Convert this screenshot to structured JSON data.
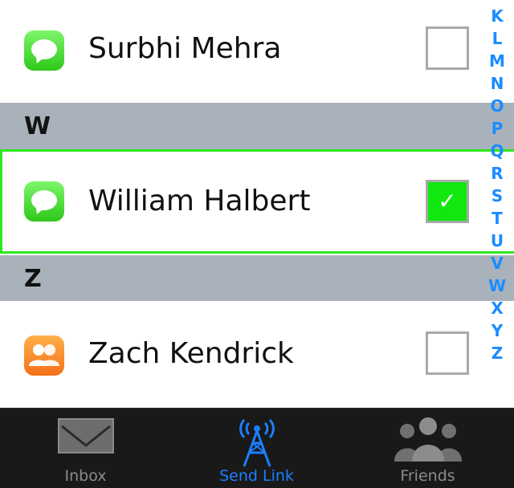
{
  "contacts": [
    {
      "name": "Surbhi Mehra",
      "icon": "messages-icon",
      "checked": false
    },
    {
      "name": "William Halbert",
      "icon": "messages-icon",
      "checked": true
    },
    {
      "name": "Zach Kendrick",
      "icon": "friends-app-icon",
      "checked": false
    }
  ],
  "sections": [
    "W",
    "Z"
  ],
  "index_letters": [
    "K",
    "L",
    "M",
    "N",
    "O",
    "P",
    "Q",
    "R",
    "S",
    "T",
    "U",
    "V",
    "W",
    "X",
    "Y",
    "Z"
  ],
  "tabs": [
    {
      "label": "Inbox",
      "icon": "envelope-icon",
      "active": false
    },
    {
      "label": "Send Link",
      "icon": "antenna-icon",
      "active": true
    },
    {
      "label": "Friends",
      "icon": "people-icon",
      "active": false
    }
  ],
  "colors": {
    "accent": "#1a7fff",
    "selected_border": "#2fe61f",
    "checkbox_checked": "#10e80f",
    "section_bg": "#a9b2bb"
  }
}
